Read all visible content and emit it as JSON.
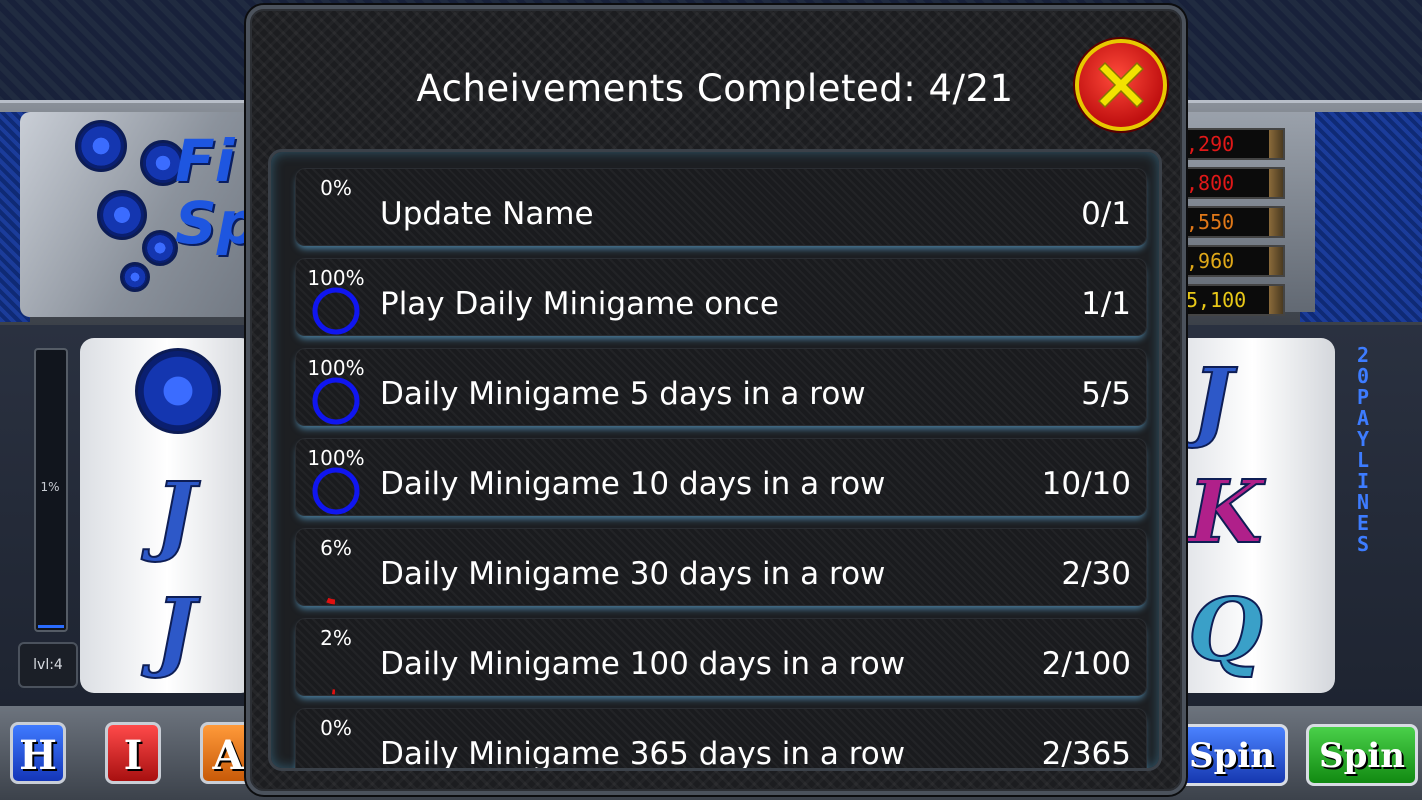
{
  "modal": {
    "title": "Acheivements Completed: 4/21",
    "close_icon": "close-x-icon",
    "colors": {
      "ring": "#1016f0",
      "partial": "#e01010",
      "close_fill": "#d81a14",
      "close_x": "#f2e200"
    }
  },
  "achievements": [
    {
      "percent_label": "0%",
      "progress": 0.0,
      "name": "Update Name",
      "count": "0/1"
    },
    {
      "percent_label": "100%",
      "progress": 1.0,
      "name": "Play Daily Minigame once",
      "count": "1/1"
    },
    {
      "percent_label": "100%",
      "progress": 1.0,
      "name": "Daily Minigame 5 days in a row",
      "count": "5/5"
    },
    {
      "percent_label": "100%",
      "progress": 1.0,
      "name": "Daily Minigame 10 days in a row",
      "count": "10/10"
    },
    {
      "percent_label": "6%",
      "progress": 0.06,
      "name": "Daily Minigame 30 days in a row",
      "count": "2/30"
    },
    {
      "percent_label": "2%",
      "progress": 0.02,
      "name": "Daily Minigame 100 days in a row",
      "count": "2/100"
    },
    {
      "percent_label": "0%",
      "progress": 0.0,
      "name": "Daily Minigame 365 days in a row",
      "count": "2/365"
    }
  ],
  "background": {
    "logo_text": "Fi\nSp",
    "paytable": [
      {
        "value": ",290",
        "color": "#e01818"
      },
      {
        "value": ",800",
        "color": "#e01818"
      },
      {
        "value": ",550",
        "color": "#e07818"
      },
      {
        "value": ",960",
        "color": "#e0a818"
      },
      {
        "value": "5,100",
        "color": "#e8c818"
      }
    ],
    "xp_label": "1%",
    "xp_progress": 0.01,
    "level_label": "lvl:4",
    "paylines_text": "20PAYLINES",
    "reel_left_symbols": [
      "J",
      "J"
    ],
    "reel_right_symbols": [
      "J",
      "K",
      "Q"
    ],
    "buttons": {
      "h": "H",
      "i": "I",
      "a": "A",
      "spin_blue": "Spin",
      "spin_green": "Spin"
    }
  }
}
